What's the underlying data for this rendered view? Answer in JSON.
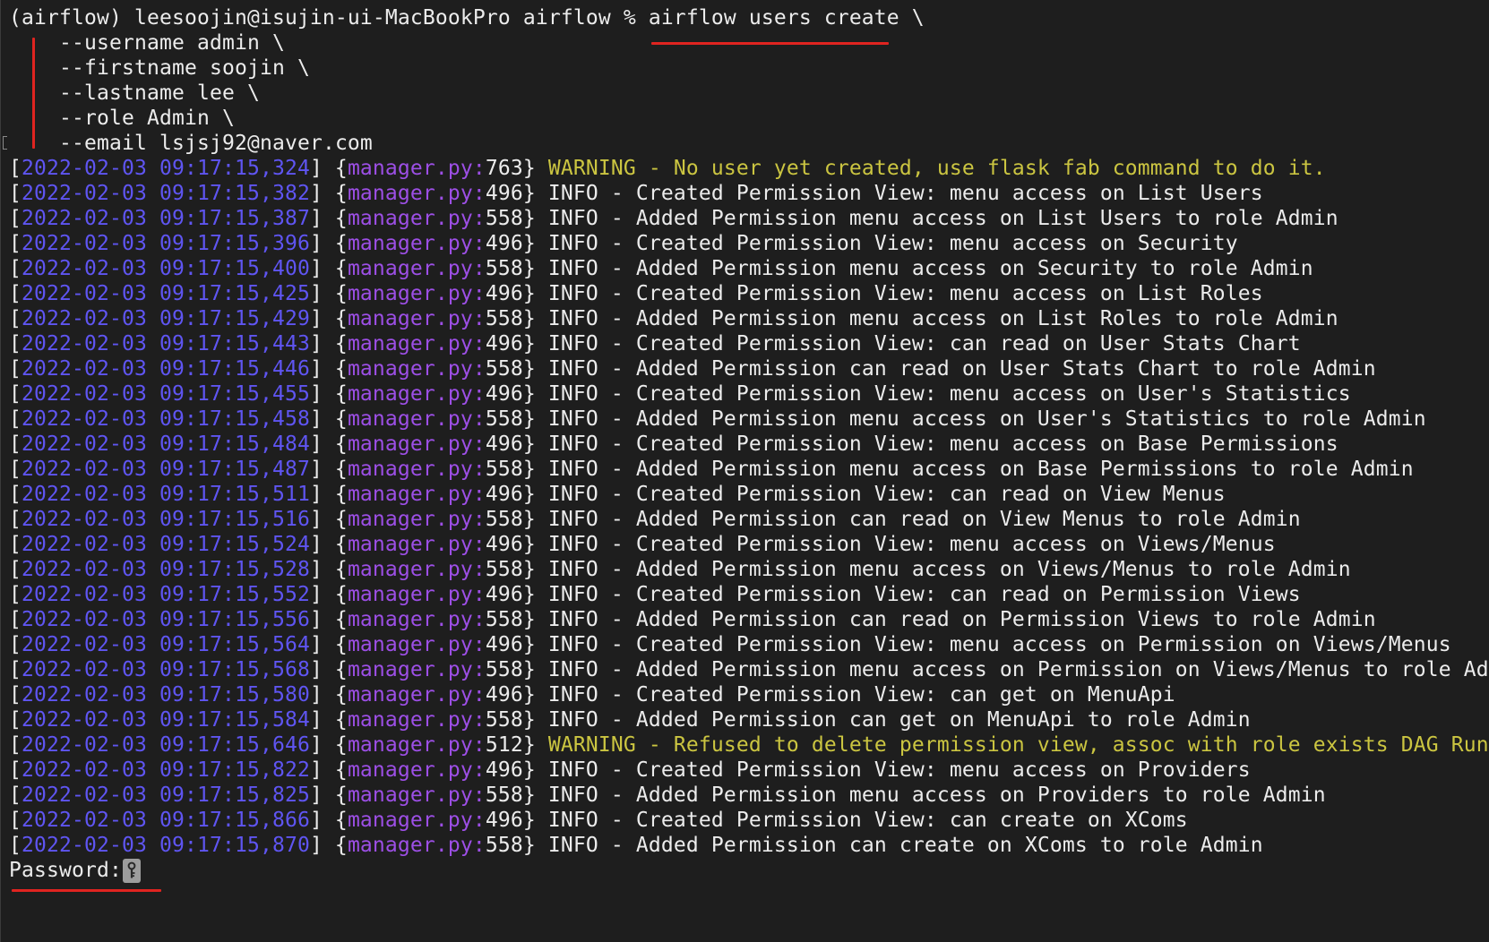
{
  "colors": {
    "background": "#1e1e1e",
    "text": "#ececec",
    "timestamp": "#5f55f2",
    "source": "#9d4fe6",
    "warning": "#cbc541",
    "annotation": "#e02420"
  },
  "icons": {
    "password_cursor": "key-icon"
  },
  "terminal": {
    "prompt": "(airflow) leesoojin@isujin-ui-MacBookPro airflow % ",
    "command": "airflow users create",
    "command_tail": " \\",
    "continuation_lines": [
      "--username admin \\",
      "--firstname soojin \\",
      "--lastname lee \\",
      "--role Admin \\",
      "--email lsjsj92@naver.com"
    ],
    "log_format": {
      "open": "[",
      "mid": "] {",
      "close": "} ",
      "sep": " - "
    },
    "log_lines": [
      {
        "timestamp": "2022-02-03 09:17:15,324",
        "source": "manager.py:",
        "lineno": "763",
        "level": "WARNING",
        "message": "No user yet created, use flask fab command to do it."
      },
      {
        "timestamp": "2022-02-03 09:17:15,382",
        "source": "manager.py:",
        "lineno": "496",
        "level": "INFO",
        "message": "Created Permission View: menu access on List Users"
      },
      {
        "timestamp": "2022-02-03 09:17:15,387",
        "source": "manager.py:",
        "lineno": "558",
        "level": "INFO",
        "message": "Added Permission menu access on List Users to role Admin"
      },
      {
        "timestamp": "2022-02-03 09:17:15,396",
        "source": "manager.py:",
        "lineno": "496",
        "level": "INFO",
        "message": "Created Permission View: menu access on Security"
      },
      {
        "timestamp": "2022-02-03 09:17:15,400",
        "source": "manager.py:",
        "lineno": "558",
        "level": "INFO",
        "message": "Added Permission menu access on Security to role Admin"
      },
      {
        "timestamp": "2022-02-03 09:17:15,425",
        "source": "manager.py:",
        "lineno": "496",
        "level": "INFO",
        "message": "Created Permission View: menu access on List Roles"
      },
      {
        "timestamp": "2022-02-03 09:17:15,429",
        "source": "manager.py:",
        "lineno": "558",
        "level": "INFO",
        "message": "Added Permission menu access on List Roles to role Admin"
      },
      {
        "timestamp": "2022-02-03 09:17:15,443",
        "source": "manager.py:",
        "lineno": "496",
        "level": "INFO",
        "message": "Created Permission View: can read on User Stats Chart"
      },
      {
        "timestamp": "2022-02-03 09:17:15,446",
        "source": "manager.py:",
        "lineno": "558",
        "level": "INFO",
        "message": "Added Permission can read on User Stats Chart to role Admin"
      },
      {
        "timestamp": "2022-02-03 09:17:15,455",
        "source": "manager.py:",
        "lineno": "496",
        "level": "INFO",
        "message": "Created Permission View: menu access on User's Statistics"
      },
      {
        "timestamp": "2022-02-03 09:17:15,458",
        "source": "manager.py:",
        "lineno": "558",
        "level": "INFO",
        "message": "Added Permission menu access on User's Statistics to role Admin"
      },
      {
        "timestamp": "2022-02-03 09:17:15,484",
        "source": "manager.py:",
        "lineno": "496",
        "level": "INFO",
        "message": "Created Permission View: menu access on Base Permissions"
      },
      {
        "timestamp": "2022-02-03 09:17:15,487",
        "source": "manager.py:",
        "lineno": "558",
        "level": "INFO",
        "message": "Added Permission menu access on Base Permissions to role Admin"
      },
      {
        "timestamp": "2022-02-03 09:17:15,511",
        "source": "manager.py:",
        "lineno": "496",
        "level": "INFO",
        "message": "Created Permission View: can read on View Menus"
      },
      {
        "timestamp": "2022-02-03 09:17:15,516",
        "source": "manager.py:",
        "lineno": "558",
        "level": "INFO",
        "message": "Added Permission can read on View Menus to role Admin"
      },
      {
        "timestamp": "2022-02-03 09:17:15,524",
        "source": "manager.py:",
        "lineno": "496",
        "level": "INFO",
        "message": "Created Permission View: menu access on Views/Menus"
      },
      {
        "timestamp": "2022-02-03 09:17:15,528",
        "source": "manager.py:",
        "lineno": "558",
        "level": "INFO",
        "message": "Added Permission menu access on Views/Menus to role Admin"
      },
      {
        "timestamp": "2022-02-03 09:17:15,552",
        "source": "manager.py:",
        "lineno": "496",
        "level": "INFO",
        "message": "Created Permission View: can read on Permission Views"
      },
      {
        "timestamp": "2022-02-03 09:17:15,556",
        "source": "manager.py:",
        "lineno": "558",
        "level": "INFO",
        "message": "Added Permission can read on Permission Views to role Admin"
      },
      {
        "timestamp": "2022-02-03 09:17:15,564",
        "source": "manager.py:",
        "lineno": "496",
        "level": "INFO",
        "message": "Created Permission View: menu access on Permission on Views/Menus"
      },
      {
        "timestamp": "2022-02-03 09:17:15,568",
        "source": "manager.py:",
        "lineno": "558",
        "level": "INFO",
        "message": "Added Permission menu access on Permission on Views/Menus to role Ad"
      },
      {
        "timestamp": "2022-02-03 09:17:15,580",
        "source": "manager.py:",
        "lineno": "496",
        "level": "INFO",
        "message": "Created Permission View: can get on MenuApi"
      },
      {
        "timestamp": "2022-02-03 09:17:15,584",
        "source": "manager.py:",
        "lineno": "558",
        "level": "INFO",
        "message": "Added Permission can get on MenuApi to role Admin"
      },
      {
        "timestamp": "2022-02-03 09:17:15,646",
        "source": "manager.py:",
        "lineno": "512",
        "level": "WARNING",
        "message": "Refused to delete permission view, assoc with role exists DAG Run"
      },
      {
        "timestamp": "2022-02-03 09:17:15,822",
        "source": "manager.py:",
        "lineno": "496",
        "level": "INFO",
        "message": "Created Permission View: menu access on Providers"
      },
      {
        "timestamp": "2022-02-03 09:17:15,825",
        "source": "manager.py:",
        "lineno": "558",
        "level": "INFO",
        "message": "Added Permission menu access on Providers to role Admin"
      },
      {
        "timestamp": "2022-02-03 09:17:15,866",
        "source": "manager.py:",
        "lineno": "496",
        "level": "INFO",
        "message": "Created Permission View: can create on XComs"
      },
      {
        "timestamp": "2022-02-03 09:17:15,870",
        "source": "manager.py:",
        "lineno": "558",
        "level": "INFO",
        "message": "Added Permission can create on XComs to role Admin"
      }
    ],
    "password_prompt": "Password:"
  }
}
